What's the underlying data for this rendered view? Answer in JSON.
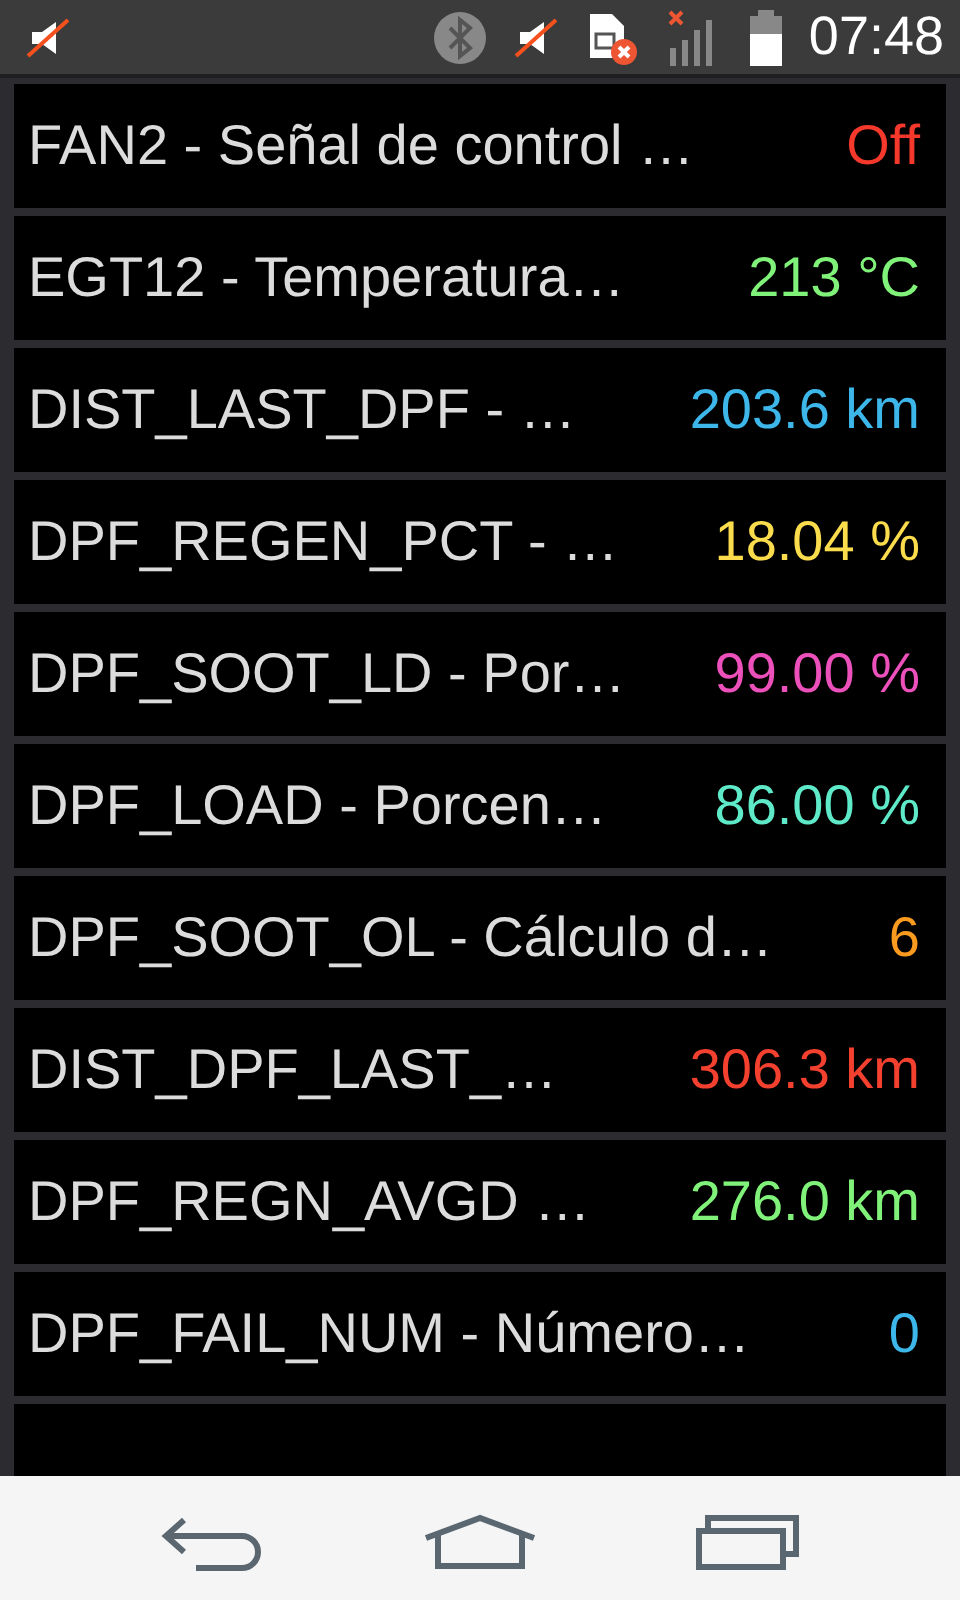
{
  "status_bar": {
    "time": "07:48"
  },
  "rows": [
    {
      "label": "FAN2 - Señal de control …",
      "value": "Off",
      "color": "#f4392c"
    },
    {
      "label": "EGT12 - Temperatura…",
      "value": "213 °C",
      "color": "#80f27a"
    },
    {
      "label": "DIST_LAST_DPF - …",
      "value": "203.6 km",
      "color": "#3db6ea"
    },
    {
      "label": "DPF_REGEN_PCT - …",
      "value": "18.04 %",
      "color": "#fadc4c"
    },
    {
      "label": "DPF_SOOT_LD - Por…",
      "value": "99.00 %",
      "color": "#ec50ba"
    },
    {
      "label": "DPF_LOAD - Porcen…",
      "value": "86.00 %",
      "color": "#5eeac8"
    },
    {
      "label": "DPF_SOOT_OL - Cálculo d…",
      "value": "6",
      "color": "#fa9a1e"
    },
    {
      "label": "DIST_DPF_LAST_…",
      "value": "306.3 km",
      "color": "#f4412f"
    },
    {
      "label": "DPF_REGN_AVGD …",
      "value": "276.0 km",
      "color": "#80f27a"
    },
    {
      "label": "DPF_FAIL_NUM - Número…",
      "value": "0",
      "color": "#3db6ea"
    }
  ]
}
